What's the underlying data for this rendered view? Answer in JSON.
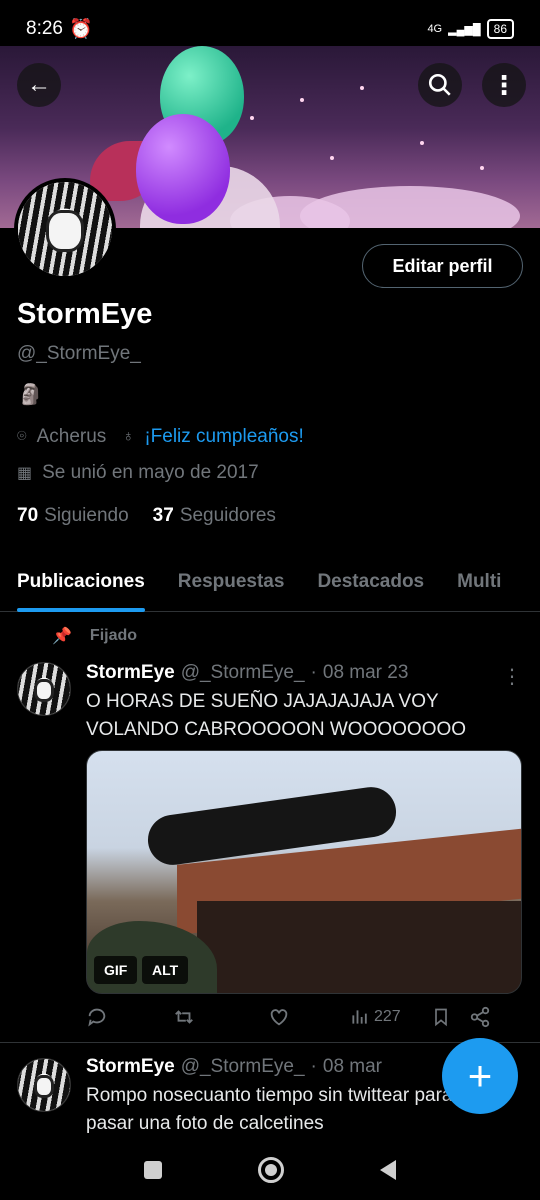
{
  "status": {
    "time": "8:26",
    "network": "4G",
    "battery": "86"
  },
  "profile": {
    "name": "StormEye",
    "handle": "@_StormEye_",
    "emoji": "🗿",
    "location": "Acherus",
    "birthday_link": "¡Feliz cumpleaños!",
    "joined": "Se unió en mayo de 2017",
    "following_count": "70",
    "following_label": "Siguiendo",
    "followers_count": "37",
    "followers_label": "Seguidores",
    "edit_button": "Editar perfil"
  },
  "tabs": [
    "Publicaciones",
    "Respuestas",
    "Destacados",
    "Multi"
  ],
  "pinned_label": "Fijado",
  "tweets": [
    {
      "name": "StormEye",
      "handle": "@_StormEye_",
      "sep": "·",
      "date": "08 mar 23",
      "text": "O HORAS DE SUEÑO JAJAJAJAJA VOY VOLANDO CABROOOOON WOOOOOOOO",
      "media_tags": [
        "GIF",
        "ALT"
      ],
      "views": "227"
    },
    {
      "name": "StormEye",
      "handle": "@_StormEye_",
      "sep": "·",
      "date": "08 mar",
      "text": "Rompo nosecuanto tiempo sin twittear para pasar una foto de calcetines"
    }
  ],
  "fab_label": "+",
  "colors": {
    "accent": "#1d9bf0",
    "muted": "#71767b",
    "background": "#000000"
  },
  "icons": [
    "back-arrow-icon",
    "search-icon",
    "more-vertical-icon",
    "location-icon",
    "balloon-icon",
    "calendar-icon",
    "pin-icon",
    "reply-icon",
    "retweet-icon",
    "like-icon",
    "views-icon",
    "bookmark-icon",
    "share-icon"
  ]
}
